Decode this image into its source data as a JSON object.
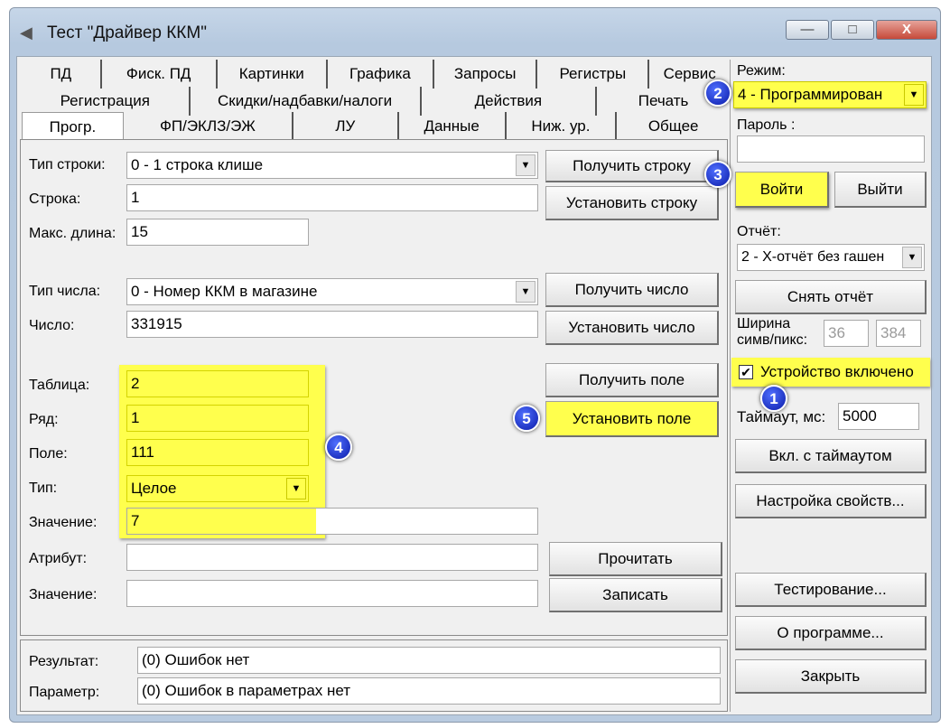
{
  "window": {
    "title": "Тест \"Драйвер ККМ\"",
    "minimize": "—",
    "maximize": "□",
    "close": "X"
  },
  "tabs": {
    "row1": [
      "ПД",
      "Фиск. ПД",
      "Картинки",
      "Графика",
      "Запросы",
      "Регистры",
      "Сервис"
    ],
    "row2": [
      "Регистрация",
      "Скидки/надбавки/налоги",
      "Действия",
      "Печать"
    ],
    "row3": [
      "Прогр.",
      "ФП/ЭКЛЗ/ЭЖ",
      "ЛУ",
      "Данные",
      "Ниж. ур.",
      "Общее"
    ]
  },
  "prog": {
    "string_type_label": "Тип строки:",
    "string_type_value": "0 - 1 строка клише",
    "string_label": "Строка:",
    "string_value": "1",
    "max_len_label": "Макс. длина:",
    "max_len_value": "15",
    "get_string": "Получить строку",
    "set_string": "Установить строку",
    "number_type_label": "Тип числа:",
    "number_type_value": "0 - Номер ККМ в магазине",
    "number_label": "Число:",
    "number_value": "331915",
    "get_number": "Получить число",
    "set_number": "Установить число",
    "table_label": "Таблица:",
    "table_value": "2",
    "row_label": "Ряд:",
    "row_value": "1",
    "field_label": "Поле:",
    "field_value": "111",
    "type_label": "Тип:",
    "type_value": "Целое",
    "value_label": "Значение:",
    "value_value": "7",
    "get_field": "Получить поле",
    "set_field": "Установить поле",
    "attr_label": "Атрибут:",
    "attr_value": "",
    "value2_label": "Значение:",
    "value2_value": "",
    "read": "Прочитать",
    "write": "Записать"
  },
  "result": {
    "result_label": "Результат:",
    "result_value": "(0) Ошибок нет",
    "param_label": "Параметр:",
    "param_value": "(0) Ошибок в параметрах нет"
  },
  "right": {
    "mode_label": "Режим:",
    "mode_value": "4 - Программирован",
    "password_label": "Пароль :",
    "password_value": "",
    "login": "Войти",
    "logout": "Выйти",
    "report_label": "Отчёт:",
    "report_value": "2 - Х-отчёт без гашен",
    "take_report": "Снять отчёт",
    "width_label": "Ширина\nсимв/пикс:",
    "width_chars": "36",
    "width_px": "384",
    "device_enabled": "Устройство включено",
    "timeout_label": "Таймаут, мс:",
    "timeout_value": "5000",
    "enable_timeout": "Вкл. с таймаутом",
    "settings": "Настройка свойств...",
    "testing": "Тестирование...",
    "about": "О программе...",
    "close": "Закрыть"
  },
  "badges": [
    "1",
    "2",
    "3",
    "4",
    "5"
  ],
  "colors": {
    "highlight": "#ffff4d",
    "badge": "#1a2fd0"
  }
}
